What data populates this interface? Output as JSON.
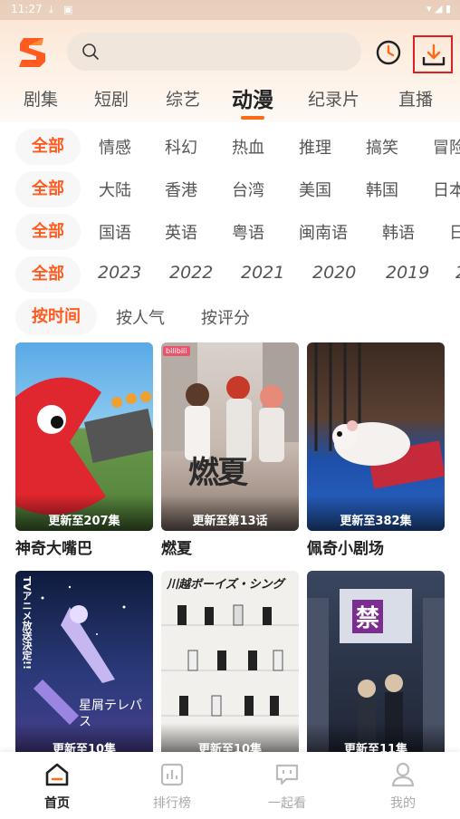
{
  "status": {
    "time": "11:27"
  },
  "search": {
    "placeholder": ""
  },
  "category_tabs": [
    "剧集",
    "短剧",
    "综艺",
    "动漫",
    "纪录片",
    "直播"
  ],
  "active_category": "动漫",
  "filters": {
    "genre": [
      "全部",
      "情感",
      "科幻",
      "热血",
      "推理",
      "搞笑",
      "冒险"
    ],
    "region": [
      "全部",
      "大陆",
      "香港",
      "台湾",
      "美国",
      "韩国",
      "日本"
    ],
    "language": [
      "全部",
      "国语",
      "英语",
      "粤语",
      "闽南语",
      "韩语",
      "日"
    ],
    "year": [
      "全部",
      "2023",
      "2022",
      "2021",
      "2020",
      "2019",
      "2"
    ],
    "sort": [
      "按时间",
      "按人气",
      "按评分"
    ]
  },
  "cards": [
    {
      "title": "神奇大嘴巴",
      "update": "更新至207集",
      "badge": ""
    },
    {
      "title": "燃夏",
      "update": "更新至第13话",
      "badge": "bilibili",
      "poster_text": "燃夏"
    },
    {
      "title": "佩奇小剧场",
      "update": "更新至382集",
      "badge": ""
    },
    {
      "title": "",
      "update": "更新至10集",
      "poster_text": "星屑テレパス",
      "poster_text2": "TVアニメ放送決定!!"
    },
    {
      "title": "",
      "update": "更新至10集",
      "poster_text": "川越ボーイズ・シング"
    },
    {
      "title": "",
      "update": "更新至11集",
      "poster_text": "禁"
    }
  ],
  "bottom_nav": [
    "首页",
    "排行榜",
    "一起看",
    "我的"
  ],
  "colors": {
    "accent": "#ff6a16",
    "download_outline": "#e02020"
  }
}
